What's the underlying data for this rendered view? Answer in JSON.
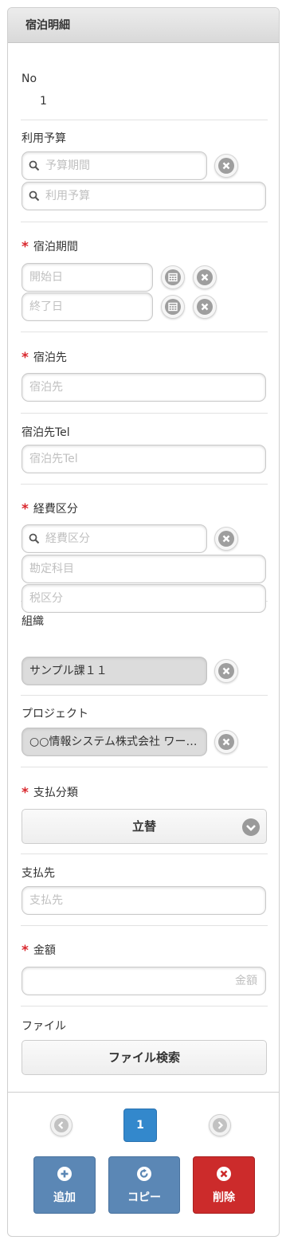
{
  "header": {
    "title": "宿泊明細"
  },
  "no": {
    "label": "No",
    "value": "1"
  },
  "budget": {
    "label": "利用予算",
    "period_placeholder": "予算期間",
    "budget_placeholder": "利用予算"
  },
  "stay_period": {
    "label": "宿泊期間",
    "start_placeholder": "開始日",
    "end_placeholder": "終了日"
  },
  "lodging": {
    "label": "宿泊先",
    "placeholder": "宿泊先"
  },
  "lodging_tel": {
    "label": "宿泊先Tel",
    "placeholder": "宿泊先Tel"
  },
  "expense": {
    "label": "経費区分",
    "placeholder": "経費区分",
    "account_placeholder": "勘定科目",
    "tax_placeholder": "税区分"
  },
  "organization": {
    "label": "組織",
    "value": "サンプル課１１"
  },
  "project": {
    "label": "プロジェクト",
    "value": "○○情報システム株式会社 ワークフロー構築"
  },
  "payment_type": {
    "label": "支払分類",
    "value": "立替"
  },
  "payee": {
    "label": "支払先",
    "placeholder": "支払先"
  },
  "amount": {
    "label": "金額",
    "placeholder": "金額"
  },
  "file": {
    "label": "ファイル",
    "button": "ファイル検索"
  },
  "required_mark": "*",
  "pagination": {
    "current": "1"
  },
  "actions": {
    "add": "追加",
    "copy": "コピー",
    "delete": "削除"
  },
  "colors": {
    "accent": "#3388cc",
    "action_blue": "#5b87b5",
    "danger": "#cc2b2b",
    "required": "#d9262c"
  }
}
